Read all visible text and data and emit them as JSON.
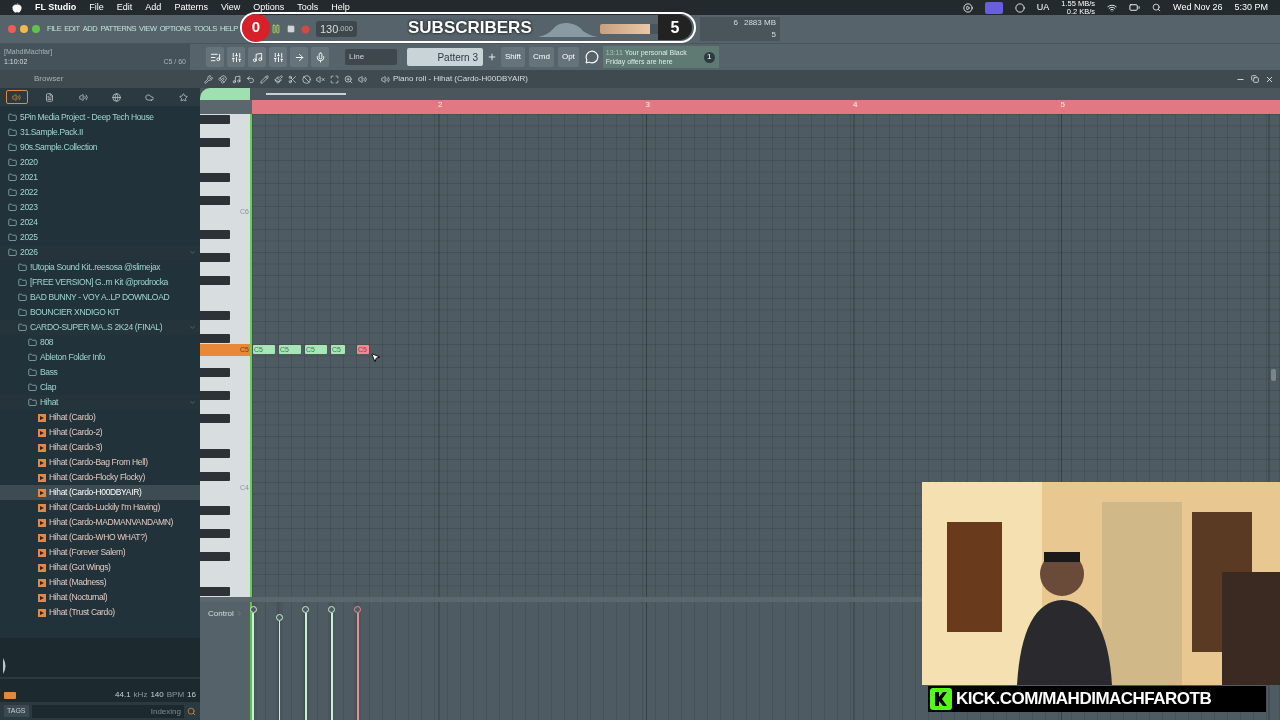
{
  "menubar": {
    "app": "FL Studio",
    "menus": [
      "File",
      "Edit",
      "Add",
      "Patterns",
      "View",
      "Options",
      "Tools",
      "Help"
    ],
    "ua": "UA",
    "net_up": "1.55 MB/s",
    "net_down": "0.2 KB/s",
    "date": "Wed Nov 26",
    "time": "5:30 PM"
  },
  "app_menu": [
    "FILE",
    "EDIT",
    "ADD",
    "PATTERNS",
    "VIEW",
    "OPTIONS",
    "TOOLS",
    "HELP"
  ],
  "transport": {
    "tempo": "130",
    "tempo_decimals": ".000"
  },
  "master_volume": {
    "level": 0.8
  },
  "monitor": {
    "cpu": "6",
    "memory": "2883 MB",
    "polyphony": "5"
  },
  "overlay": {
    "count": "0",
    "label": "SUBSCRIBERS",
    "goal": "5"
  },
  "hint_bar": {
    "user": "[MahdiMachfar]",
    "time": "1:10:02",
    "note": "C5 / 60"
  },
  "snap": "Line",
  "pattern": "Pattern 3",
  "modifiers": [
    "Shift",
    "Cmd",
    "Opt"
  ],
  "news": {
    "time": "13:11",
    "text": "Your personal Black Friday offers are here",
    "badge": "1"
  },
  "browser": {
    "title": "Browser",
    "tabs": [
      {
        "selected": true
      },
      {
        "selected": false
      },
      {
        "selected": false
      },
      {
        "selected": false
      },
      {
        "selected": false
      },
      {
        "selected": false
      }
    ],
    "tree": [
      {
        "name": "5Pin Media Project - Deep Tech House",
        "kind": "folder",
        "expanded": false,
        "selected": false
      },
      {
        "name": "31.Sample.Pack.II",
        "kind": "folder",
        "expanded": false,
        "selected": false
      },
      {
        "name": "90s.Sample.Collection",
        "kind": "folder",
        "expanded": false,
        "selected": false
      },
      {
        "name": "2020",
        "kind": "folder",
        "expanded": false,
        "selected": false
      },
      {
        "name": "2021",
        "kind": "folder",
        "expanded": false,
        "selected": false
      },
      {
        "name": "2022",
        "kind": "folder",
        "expanded": false,
        "selected": false
      },
      {
        "name": "2023",
        "kind": "folder",
        "expanded": false,
        "selected": false
      },
      {
        "name": "2024",
        "kind": "folder",
        "expanded": false,
        "selected": false
      },
      {
        "name": "2025",
        "kind": "folder",
        "expanded": false,
        "selected": false
      },
      {
        "name": "2026",
        "kind": "folder",
        "expanded": true,
        "selected": false,
        "children": [
          {
            "name": "!Utopia Sound Kit..reesosa @slimejax",
            "kind": "folder",
            "expanded": false,
            "selected": false
          },
          {
            "name": "[FREE VERSION] G..m Kit @prodrocka",
            "kind": "folder",
            "expanded": false,
            "selected": false
          },
          {
            "name": "BAD BUNNY - VOY A..LP DOWNLOAD",
            "kind": "folder",
            "expanded": false,
            "selected": false
          },
          {
            "name": "BOUNCIER XNDIGO KIT",
            "kind": "folder",
            "expanded": false,
            "selected": false
          },
          {
            "name": "CARDO-SUPER MA..S 2K24 (FINAL)",
            "kind": "folder",
            "expanded": true,
            "selected": false,
            "children": [
              {
                "name": "808",
                "kind": "folder",
                "expanded": false,
                "selected": false
              },
              {
                "name": "Ableton Folder Info",
                "kind": "folder",
                "expanded": false,
                "selected": false
              },
              {
                "name": "Bass",
                "kind": "folder",
                "expanded": false,
                "selected": false
              },
              {
                "name": "Clap",
                "kind": "folder",
                "expanded": false,
                "selected": false
              },
              {
                "name": "Hihat",
                "kind": "folder",
                "expanded": true,
                "selected": false,
                "children": [
                  {
                    "name": "Hihat (Cardo)",
                    "kind": "sample",
                    "selected": false
                  },
                  {
                    "name": "Hihat (Cardo-2)",
                    "kind": "sample",
                    "selected": false
                  },
                  {
                    "name": "Hihat (Cardo-3)",
                    "kind": "sample",
                    "selected": false
                  },
                  {
                    "name": "Hihat (Cardo-Bag From Hell)",
                    "kind": "sample",
                    "selected": false
                  },
                  {
                    "name": "Hihat (Cardo-Flocky Flocky)",
                    "kind": "sample",
                    "selected": false
                  },
                  {
                    "name": "Hihat (Cardo-H00DBYAIR)",
                    "kind": "sample",
                    "selected": true
                  },
                  {
                    "name": "Hihat (Cardo-Luckily I'm Having)",
                    "kind": "sample",
                    "selected": false
                  },
                  {
                    "name": "Hihat (Cardo-MADMANVANDAMN)",
                    "kind": "sample",
                    "selected": false
                  },
                  {
                    "name": "Hihat (Cardo-WHO WHAT?)",
                    "kind": "sample",
                    "selected": false
                  },
                  {
                    "name": "Hihat (Forever Salem)",
                    "kind": "sample",
                    "selected": false
                  },
                  {
                    "name": "Hihat (Got Wings)",
                    "kind": "sample",
                    "selected": false
                  },
                  {
                    "name": "Hihat (Madness)",
                    "kind": "sample",
                    "selected": false
                  },
                  {
                    "name": "Hihat (Nocturnal)",
                    "kind": "sample",
                    "selected": false
                  },
                  {
                    "name": "Hihat (Trust Cardo)",
                    "kind": "sample",
                    "selected": false
                  }
                ]
              }
            ]
          }
        ]
      }
    ],
    "footer": {
      "rate": "44.1",
      "rate_unit": "kHz",
      "tempo": "140",
      "tempo_unit": "BPM",
      "beats": "16",
      "tags": "TAGS",
      "placeholder": "Indexing"
    }
  },
  "piano_roll": {
    "title": "Piano roll - Hihat (Cardo-H00DBYAIR)",
    "bars": [
      "2",
      "3",
      "4",
      "5"
    ],
    "keys": [
      {
        "label": "C6",
        "selected": false
      },
      {
        "label": "C5",
        "selected": true
      },
      {
        "label": "C4",
        "selected": false
      }
    ],
    "notes": [
      {
        "label": "C5",
        "selected": false,
        "level": 0.91
      },
      {
        "label": "C5",
        "selected": false,
        "level": 0.84
      },
      {
        "label": "C5",
        "selected": false,
        "level": 0.91
      },
      {
        "label": "C5",
        "selected": false,
        "level": 0.91
      },
      {
        "label": "C5",
        "selected": true,
        "level": 0.91
      }
    ],
    "event_lane": "Control"
  },
  "banner": "KICK.COM/MAHDIMACHFAROTB"
}
